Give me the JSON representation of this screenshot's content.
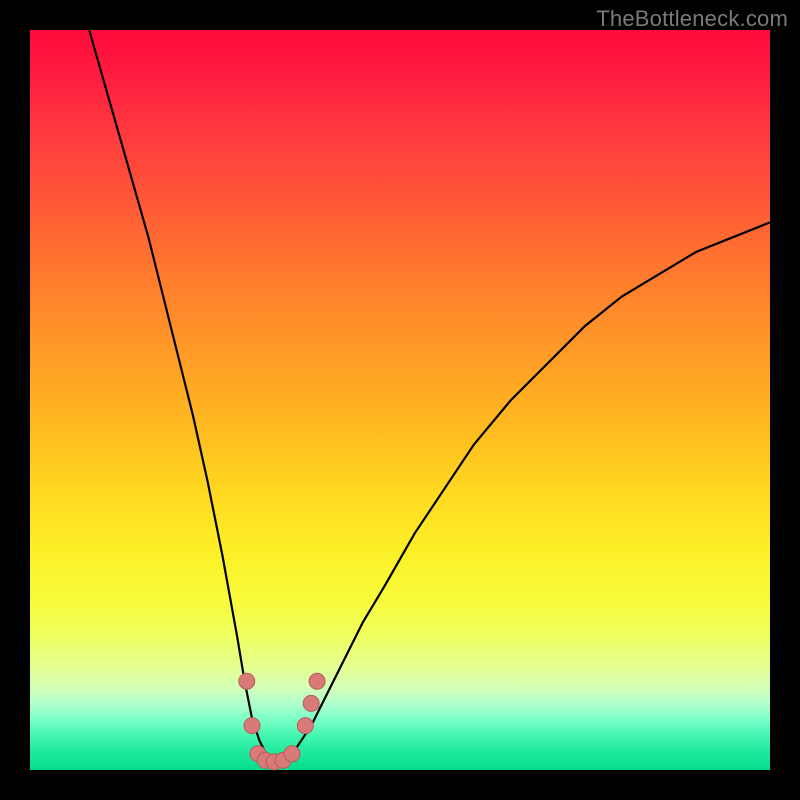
{
  "watermark": "TheBottleneck.com",
  "colors": {
    "frame": "#000000",
    "curve_stroke": "#000000",
    "marker_fill": "#d87a78",
    "marker_stroke": "#b85d5b"
  },
  "chart_data": {
    "type": "line",
    "title": "",
    "xlabel": "",
    "ylabel": "",
    "xlim": [
      0,
      100
    ],
    "ylim": [
      0,
      100
    ],
    "grid": false,
    "legend": false,
    "annotations": [
      "TheBottleneck.com"
    ],
    "series": [
      {
        "name": "bottleneck-curve",
        "x": [
          8,
          10,
          12,
          14,
          16,
          18,
          20,
          22,
          24,
          26,
          28,
          29,
          30,
          31,
          32,
          33,
          34,
          35,
          36,
          38,
          40,
          42,
          45,
          48,
          52,
          56,
          60,
          65,
          70,
          75,
          80,
          85,
          90,
          95,
          100
        ],
        "y": [
          100,
          93,
          86,
          79,
          72,
          64,
          56,
          48,
          39,
          29,
          18,
          12,
          7,
          4,
          2,
          1,
          1,
          2,
          3,
          6,
          10,
          14,
          20,
          25,
          32,
          38,
          44,
          50,
          55,
          60,
          64,
          67,
          70,
          72,
          74
        ]
      }
    ],
    "markers": [
      {
        "x": 29.3,
        "y": 12
      },
      {
        "x": 30.0,
        "y": 6
      },
      {
        "x": 30.8,
        "y": 2.2
      },
      {
        "x": 31.8,
        "y": 1.3
      },
      {
        "x": 33.0,
        "y": 1.1
      },
      {
        "x": 34.2,
        "y": 1.3
      },
      {
        "x": 35.4,
        "y": 2.2
      },
      {
        "x": 37.2,
        "y": 6
      },
      {
        "x": 38.0,
        "y": 9
      },
      {
        "x": 38.8,
        "y": 12
      }
    ]
  }
}
